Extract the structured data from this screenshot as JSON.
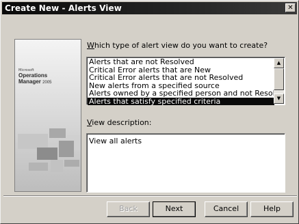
{
  "window": {
    "title": "Create New - Alerts View",
    "close_glyph": "✕"
  },
  "branding": {
    "company": "Microsoft",
    "product_line1": "Operations",
    "product_line2": "Manager",
    "version": "2005"
  },
  "question": {
    "accel": "W",
    "text_rest": "hich type of alert view do you want to create?"
  },
  "alert_types": {
    "items": [
      {
        "label": "Alerts that are not Resolved",
        "selected": false
      },
      {
        "label": "Critical Error alerts that are New",
        "selected": false
      },
      {
        "label": "Critical Error alerts that are not Resolved",
        "selected": false
      },
      {
        "label": "New alerts from a specified source",
        "selected": false
      },
      {
        "label": "Alerts owned by a specified person and not Resolved",
        "selected": false
      },
      {
        "label": "Alerts that satisfy specified criteria",
        "selected": true
      }
    ],
    "scroll_up_glyph": "▲",
    "scroll_down_glyph": "▼"
  },
  "description": {
    "label_accel": "V",
    "label_rest": "iew description:",
    "text": "View all alerts"
  },
  "buttons": {
    "back": {
      "label": "Back",
      "enabled": false
    },
    "next": {
      "label": "Next",
      "enabled": true
    },
    "cancel": {
      "label": "Cancel",
      "enabled": true
    },
    "help": {
      "label": "Help",
      "enabled": true
    }
  },
  "colors": {
    "selection": "#0a0a0a",
    "dialog_face": "#d4d0c8",
    "titlebar": "#0a0a0a"
  }
}
